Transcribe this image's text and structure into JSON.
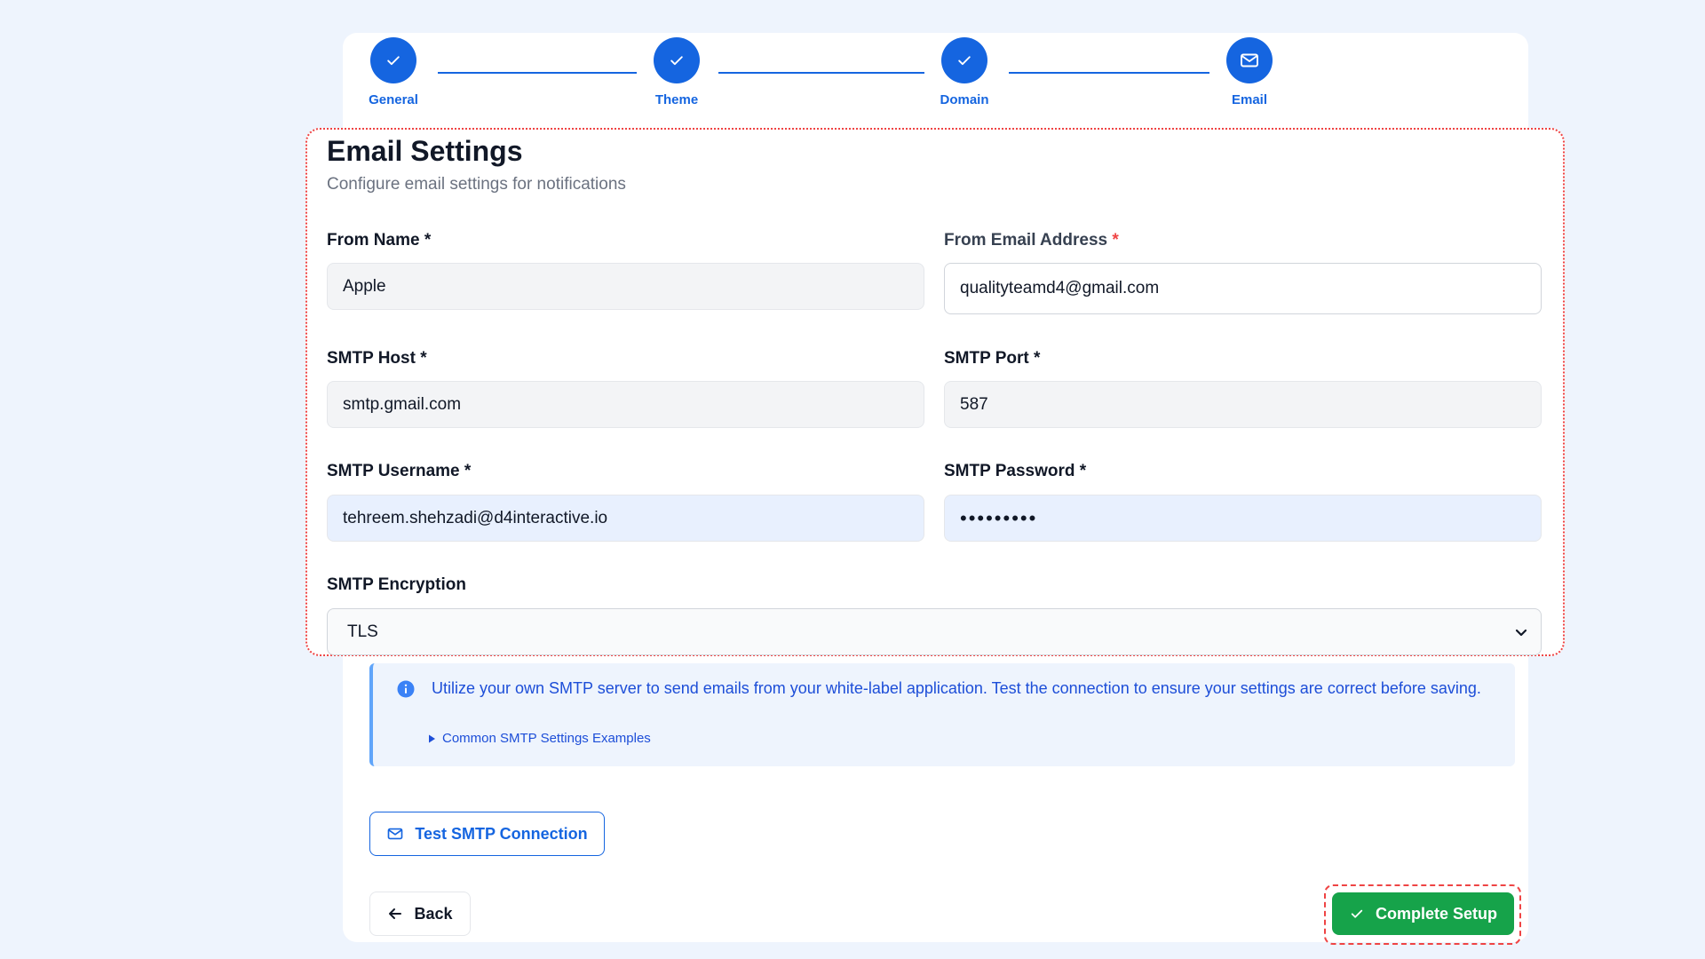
{
  "stepper": {
    "steps": [
      {
        "label": "General",
        "status": "complete",
        "icon": "check-icon"
      },
      {
        "label": "Theme",
        "status": "complete",
        "icon": "check-icon"
      },
      {
        "label": "Domain",
        "status": "complete",
        "icon": "check-icon"
      },
      {
        "label": "Email",
        "status": "current",
        "icon": "mail-icon"
      }
    ]
  },
  "form": {
    "title": "Email Settings",
    "subtitle": "Configure email settings for notifications",
    "from_name": {
      "label": "From Name",
      "required_mark": "*",
      "value": "Apple"
    },
    "from_email": {
      "label": "From Email Address",
      "required_mark": "*",
      "value": "qualityteamd4@gmail.com"
    },
    "smtp_host": {
      "label": "SMTP Host",
      "required_mark": "*",
      "value": "smtp.gmail.com"
    },
    "smtp_port": {
      "label": "SMTP Port",
      "required_mark": "*",
      "value": "587"
    },
    "smtp_username": {
      "label": "SMTP Username",
      "required_mark": "*",
      "value": "tehreem.shehzadi@d4interactive.io"
    },
    "smtp_password": {
      "label": "SMTP Password",
      "required_mark": "*",
      "value": "•••••••••"
    },
    "smtp_encryption": {
      "label": "SMTP Encryption",
      "value": "TLS"
    }
  },
  "info": {
    "text": "Utilize your own SMTP server to send emails from your white-label application. Test the connection to ensure your settings are correct before saving.",
    "details_label": "Common SMTP Settings Examples"
  },
  "buttons": {
    "test": "Test SMTP Connection",
    "back": "Back",
    "complete": "Complete Setup"
  },
  "colors": {
    "primary": "#1565e0",
    "success": "#16a34a",
    "highlight": "#ef4444",
    "background": "#eef4fd"
  }
}
